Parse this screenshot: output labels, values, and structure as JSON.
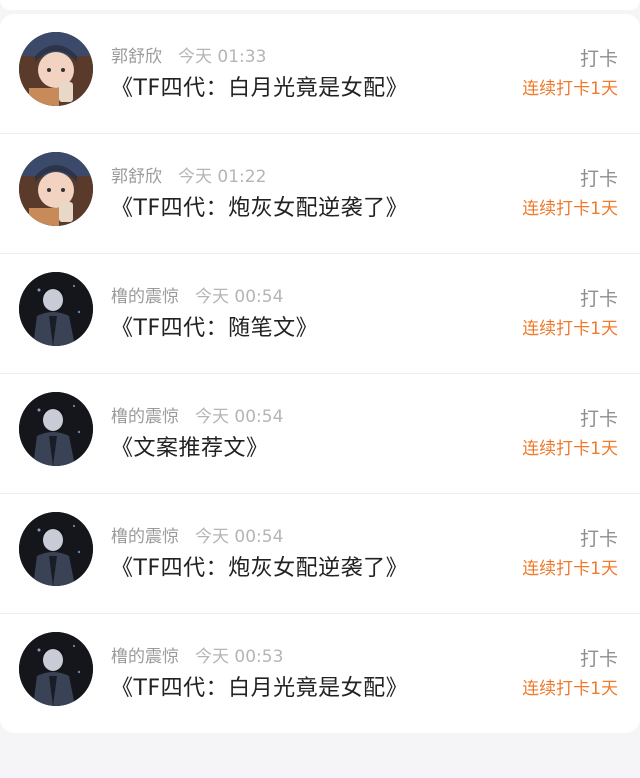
{
  "feed": {
    "items": [
      {
        "user": "郭舒欣",
        "time": "今天 01:33",
        "title": "《TF四代：白月光竟是女配》",
        "action": "打卡",
        "streak": "连续打卡1天",
        "avatar_icon": "avatar-photo-girl-icon"
      },
      {
        "user": "郭舒欣",
        "time": "今天 01:22",
        "title": "《TF四代：炮灰女配逆袭了》",
        "action": "打卡",
        "streak": "连续打卡1天",
        "avatar_icon": "avatar-photo-girl-icon"
      },
      {
        "user": "橹的震惊",
        "time": "今天 00:54",
        "title": "《TF四代：随笔文》",
        "action": "打卡",
        "streak": "连续打卡1天",
        "avatar_icon": "avatar-dark-figure-icon"
      },
      {
        "user": "橹的震惊",
        "time": "今天 00:54",
        "title": "《文案推荐文》",
        "action": "打卡",
        "streak": "连续打卡1天",
        "avatar_icon": "avatar-dark-figure-icon"
      },
      {
        "user": "橹的震惊",
        "time": "今天 00:54",
        "title": "《TF四代：炮灰女配逆袭了》",
        "action": "打卡",
        "streak": "连续打卡1天",
        "avatar_icon": "avatar-dark-figure-icon"
      },
      {
        "user": "橹的震惊",
        "time": "今天 00:53",
        "title": "《TF四代：白月光竟是女配》",
        "action": "打卡",
        "streak": "连续打卡1天",
        "avatar_icon": "avatar-dark-figure-icon"
      }
    ]
  },
  "colors": {
    "streak": "#f07a2c",
    "username": "#9b9b9b",
    "title": "#222222",
    "background": "#f5f5f7"
  }
}
